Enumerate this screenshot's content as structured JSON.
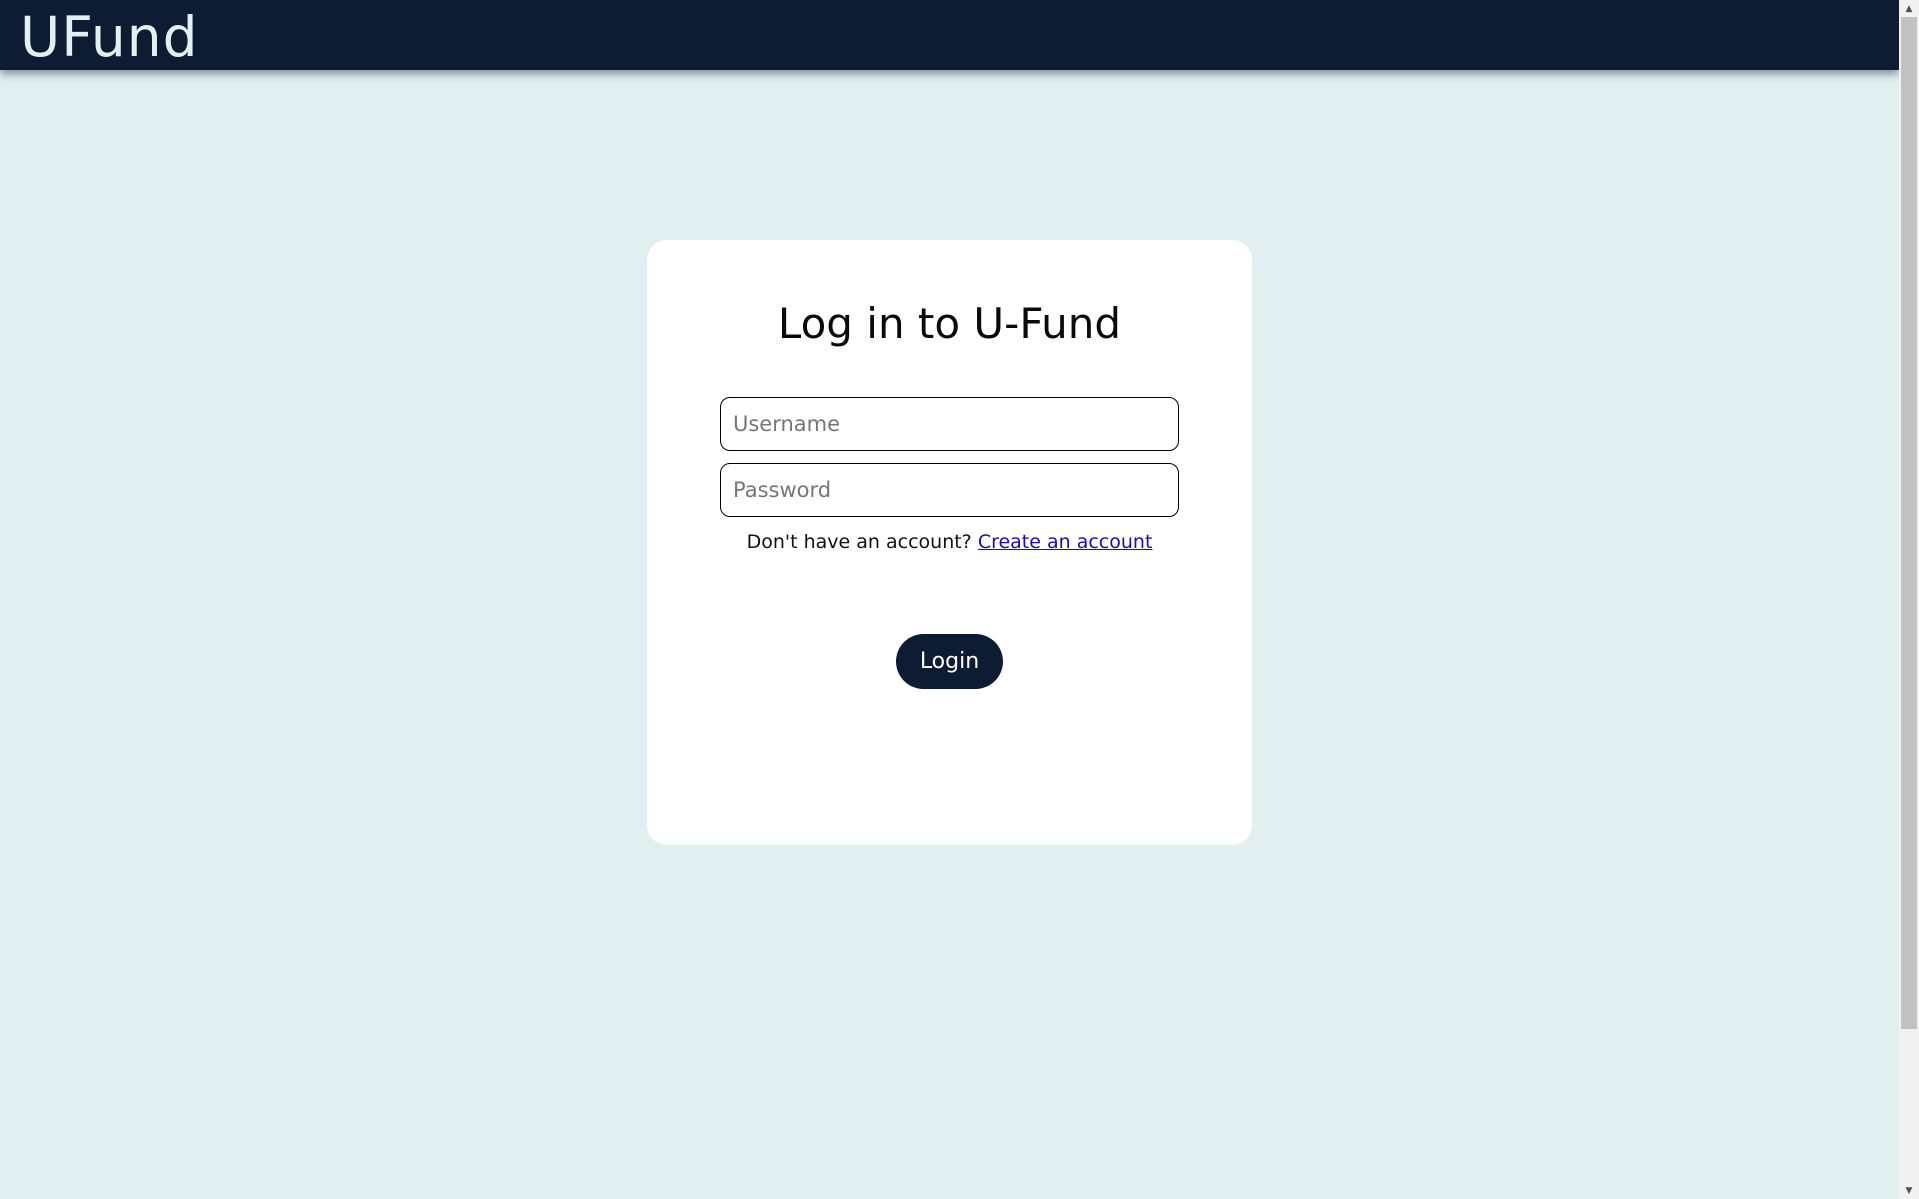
{
  "header": {
    "brand": "UFund"
  },
  "login": {
    "title": "Log in to U-Fund",
    "username_placeholder": "Username",
    "username_value": "",
    "password_placeholder": "Password",
    "password_value": "",
    "signup_prompt": "Don't have an account?",
    "signup_link": "Create an account",
    "submit_label": "Login"
  },
  "scrollbar": {
    "up_icon": "arrow-up-icon",
    "down_icon": "arrow-down-icon"
  },
  "colors": {
    "page_background": "#e1eff1",
    "header_background": "#0e1c33",
    "brand_text": "#e3f0f2",
    "card_background": "#ffffff",
    "button_background": "#0e1c33",
    "link": "#1a0dab"
  }
}
